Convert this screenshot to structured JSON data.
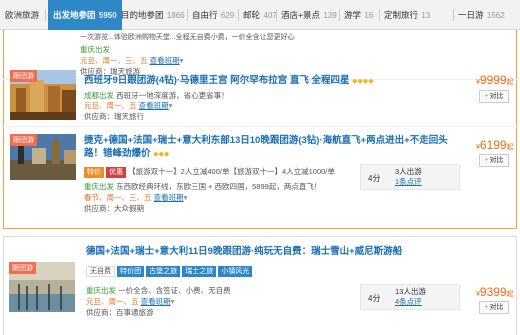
{
  "tabs": [
    {
      "label": "欧洲旅游",
      "count": ""
    },
    {
      "label": "出发地参团",
      "count": "5950"
    },
    {
      "label": "目的地参团",
      "count": "1866"
    },
    {
      "label": "自由行",
      "count": "629"
    },
    {
      "label": "邮轮",
      "count": "407"
    },
    {
      "label": "酒店+景点",
      "count": "139"
    },
    {
      "label": "游学",
      "count": "16"
    },
    {
      "label": "定制旅行",
      "count": "13"
    },
    {
      "label": "一日游",
      "count": "1562"
    }
  ],
  "card0": {
    "line1": "一次游览...体验欧洲购物天堂...全程无自费小费，一价全含让您更好心",
    "dep_label": "重庆出发",
    "dep_text": "元旦、周一、三、五",
    "schedule_link": "查看班期",
    "supplier": "供应商：瑞天旅游"
  },
  "card1": {
    "badge": "跟团游",
    "title": "西班牙9日跟团游(4钻)·马德里王宫 阿尔罕布拉宫 直飞 全程四星",
    "diamonds": "◆◆◆◆",
    "dep_label": "成都出发",
    "dep_desc": "西班牙一地深度游，省心更省事！",
    "date_label": "元旦、周一、五",
    "schedule_link": "查看班期",
    "supplier": "供应商：瑞天旅行",
    "price": "9999",
    "price_suffix": "起",
    "compare": "对比"
  },
  "card2": {
    "badge": "跟团游",
    "title": "捷克+德国+法国+瑞士+意大利东部13日10晚跟团游(3钻)·海航直飞+两点进出+不走回头路！错峰劲爆价",
    "diamonds": "◆◆◆",
    "tag1": "特价",
    "tag2": "优惠",
    "offer": "【旅游双十一】2人立减400/单【旅游双十一】4人立减1000/单",
    "dep_label": "重庆出发",
    "dep_desc": "东西欧经典环线，东欧三国 + 西欧四国，5899起，两点直飞！",
    "date_label": "春节、周一、三、五",
    "schedule_link": "查看班期",
    "supplier": "供应商：大众假期",
    "score": "4分",
    "people": "3人出游",
    "reviews": "1条点评",
    "price": "6199",
    "price_suffix": "起",
    "compare": "对比"
  },
  "card3": {
    "badge": "跟团游",
    "title": "德国+法国+瑞士+意大利11日9晚跟团游·纯玩无自费：瑞士雪山+威尼斯游船",
    "tags": [
      "无自费",
      "特价团",
      "古堡之旅",
      "瑞士之旅",
      "小镇风光"
    ],
    "dep_label": "重庆出发",
    "dep_desc": "一价全含、含签证、小费、无自费",
    "date_label": "元旦、周一、五",
    "schedule_link": "查看班期",
    "supplier": "供应商：百事通旅游",
    "score": "4分",
    "people": "13人出游",
    "reviews": "4条点评",
    "price": "9399",
    "price_suffix": "起",
    "compare": "对比"
  },
  "colors": {
    "accent": "#2e88c8",
    "price": "#f26a11",
    "frame": "#f6a232",
    "badge": "#f26c4f",
    "link": "#1a6fb3"
  }
}
